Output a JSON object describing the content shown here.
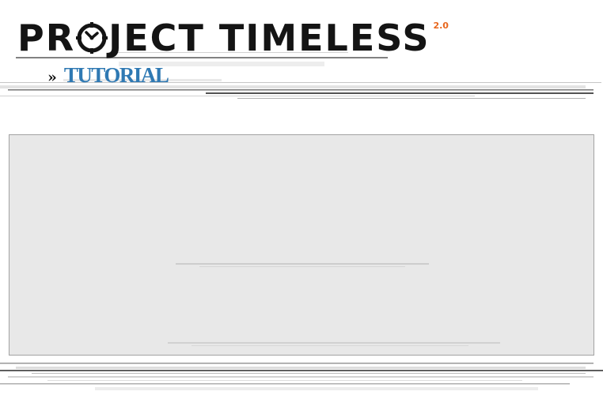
{
  "header": {
    "logo": {
      "title_part1": "PR",
      "title_part2": "JECT TIMELESS",
      "version": "2.0",
      "icon": "clock-icon"
    },
    "section": {
      "prefix": "»",
      "label": "TUTORIAL"
    }
  },
  "main": {
    "content_box": {
      "background": "#e8e8e8",
      "border": "#a3a3a3"
    }
  },
  "colors": {
    "accent_orange": "#e8671e",
    "link_blue": "#2f79b3",
    "logo_black": "#141414"
  }
}
